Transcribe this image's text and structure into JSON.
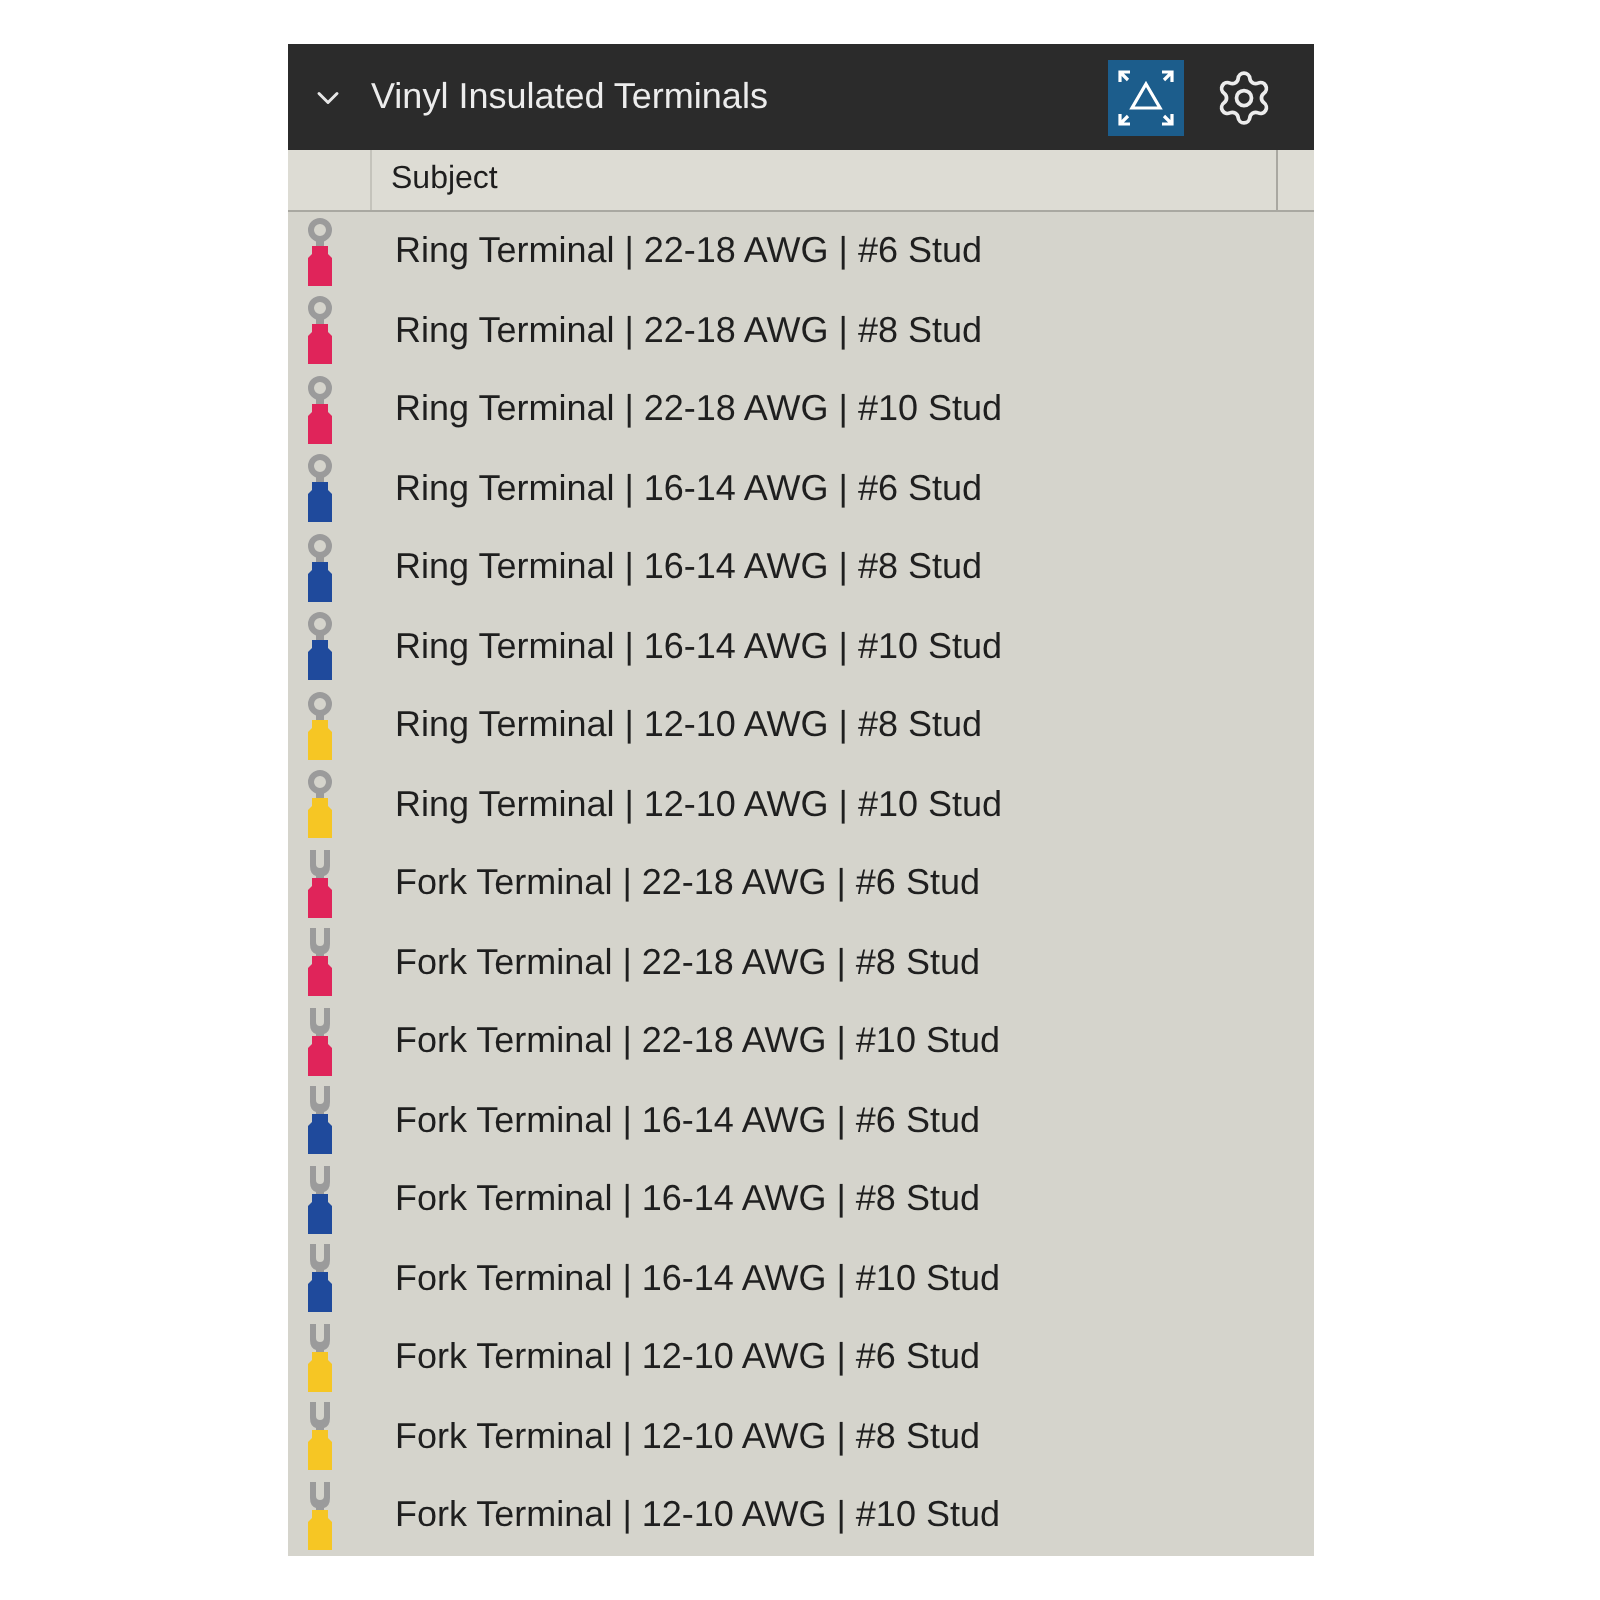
{
  "panel": {
    "title": "Vinyl Insulated Terminals",
    "expanded": true,
    "view_toggle": {
      "selected": true
    }
  },
  "table": {
    "columns": [
      "Subject"
    ],
    "rows": [
      {
        "kind": "ring",
        "color": "#e0245a",
        "subject": "Ring Terminal | 22-18 AWG | #6 Stud"
      },
      {
        "kind": "ring",
        "color": "#e0245a",
        "subject": "Ring Terminal | 22-18 AWG | #8 Stud"
      },
      {
        "kind": "ring",
        "color": "#e0245a",
        "subject": "Ring Terminal | 22-18 AWG | #10 Stud"
      },
      {
        "kind": "ring",
        "color": "#1f4a9c",
        "subject": "Ring Terminal | 16-14 AWG | #6 Stud"
      },
      {
        "kind": "ring",
        "color": "#1f4a9c",
        "subject": "Ring Terminal | 16-14 AWG | #8 Stud"
      },
      {
        "kind": "ring",
        "color": "#1f4a9c",
        "subject": "Ring Terminal | 16-14 AWG | #10 Stud"
      },
      {
        "kind": "ring",
        "color": "#f6c624",
        "subject": "Ring Terminal | 12-10 AWG | #8 Stud"
      },
      {
        "kind": "ring",
        "color": "#f6c624",
        "subject": "Ring Terminal | 12-10 AWG | #10 Stud"
      },
      {
        "kind": "fork",
        "color": "#e0245a",
        "subject": "Fork Terminal | 22-18 AWG | #6 Stud"
      },
      {
        "kind": "fork",
        "color": "#e0245a",
        "subject": "Fork Terminal | 22-18 AWG | #8 Stud"
      },
      {
        "kind": "fork",
        "color": "#e0245a",
        "subject": "Fork Terminal | 22-18 AWG | #10 Stud"
      },
      {
        "kind": "fork",
        "color": "#1f4a9c",
        "subject": "Fork Terminal | 16-14 AWG | #6 Stud"
      },
      {
        "kind": "fork",
        "color": "#1f4a9c",
        "subject": "Fork Terminal | 16-14 AWG | #8 Stud"
      },
      {
        "kind": "fork",
        "color": "#1f4a9c",
        "subject": "Fork Terminal | 16-14 AWG | #10 Stud"
      },
      {
        "kind": "fork",
        "color": "#f6c624",
        "subject": "Fork Terminal | 12-10 AWG | #6 Stud"
      },
      {
        "kind": "fork",
        "color": "#f6c624",
        "subject": "Fork Terminal | 12-10 AWG | #8 Stud"
      },
      {
        "kind": "fork",
        "color": "#f6c624",
        "subject": "Fork Terminal | 12-10 AWG | #10 Stud"
      }
    ]
  }
}
